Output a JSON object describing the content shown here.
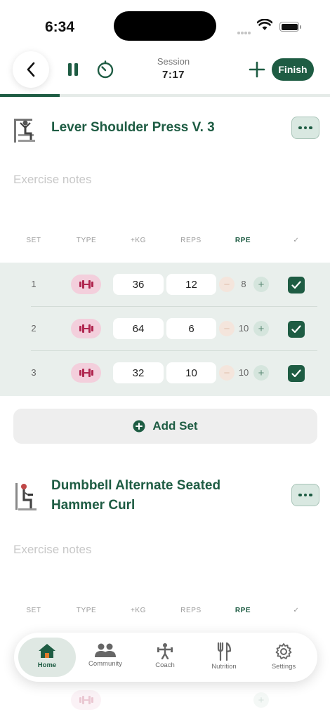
{
  "status_bar": {
    "time": "6:34"
  },
  "header": {
    "session_label": "Session",
    "session_time": "7:17",
    "finish_label": "Finish",
    "progress_fraction": 0.18
  },
  "columns": {
    "set": "SET",
    "type": "TYPE",
    "kg": "+KG",
    "reps": "REPS",
    "rpe": "RPE",
    "check": "✓"
  },
  "exercises": [
    {
      "title": "Lever Shoulder Press V. 3",
      "notes_placeholder": "Exercise notes",
      "sets": [
        {
          "set": "1",
          "kg": "36",
          "reps": "12",
          "rpe": "8",
          "done": true
        },
        {
          "set": "2",
          "kg": "64",
          "reps": "6",
          "rpe": "10",
          "done": true
        },
        {
          "set": "3",
          "kg": "32",
          "reps": "10",
          "rpe": "10",
          "done": true
        }
      ],
      "add_set_label": "Add Set"
    },
    {
      "title_line1": "Dumbbell Alternate Seated",
      "title_line2": "Hammer Curl",
      "notes_placeholder": "Exercise notes"
    }
  ],
  "tabbar": {
    "items": [
      {
        "label": "Home",
        "icon": "home-icon",
        "active": true
      },
      {
        "label": "Community",
        "icon": "community-icon",
        "active": false
      },
      {
        "label": "Coach",
        "icon": "coach-icon",
        "active": false
      },
      {
        "label": "Nutrition",
        "icon": "nutrition-icon",
        "active": false
      },
      {
        "label": "Settings",
        "icon": "settings-icon",
        "active": false
      }
    ]
  },
  "colors": {
    "accent": "#1e5c43",
    "type_pill": "#f3cfdc",
    "set_rows_bg": "#e9efec"
  }
}
